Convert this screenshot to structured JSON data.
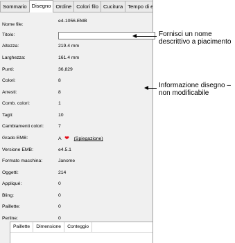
{
  "tabs": [
    "Sommario",
    "Disegno",
    "Ordine",
    "Colori filo",
    "Cucitura",
    "Tempo di esecu"
  ],
  "active_tab_index": 1,
  "fields": [
    {
      "label": "Nome file:",
      "value": "e4-1056.EMB"
    },
    {
      "label": "Titolo:",
      "value": ""
    },
    {
      "label": "Altezza:",
      "value": "219.4 mm"
    },
    {
      "label": "Larghezza:",
      "value": "161.4 mm"
    },
    {
      "label": "Punti:",
      "value": "36,829"
    },
    {
      "label": "Colori:",
      "value": "8"
    },
    {
      "label": "Arresti:",
      "value": "8"
    },
    {
      "label": "Comb. colori:",
      "value": "1"
    },
    {
      "label": "Tagli:",
      "value": "10"
    },
    {
      "label": "Cambiamenti colori:",
      "value": "7"
    },
    {
      "label": "Grado EMB:",
      "value": "A"
    },
    {
      "label": "Versione EMB:",
      "value": "e4.5.1"
    },
    {
      "label": "Formato macchina:",
      "value": "Janome"
    },
    {
      "label": "Oggetti:",
      "value": "214"
    },
    {
      "label": "Appliqué:",
      "value": "0"
    },
    {
      "label": "Bling:",
      "value": "0"
    },
    {
      "label": "Paillette:",
      "value": "0"
    },
    {
      "label": "Perline:",
      "value": "0"
    }
  ],
  "grade_link": "(Spiegazione)",
  "heart_icon": "heart-icon",
  "heart_color": "#e30b17",
  "grid_columns": [
    "Paillette",
    "Dimensione",
    "Conteggio"
  ],
  "annotations": {
    "title_note": "Fornisci un nome descrittivo a piacimento",
    "info_note": "Informazione disegno – non modificabile"
  }
}
